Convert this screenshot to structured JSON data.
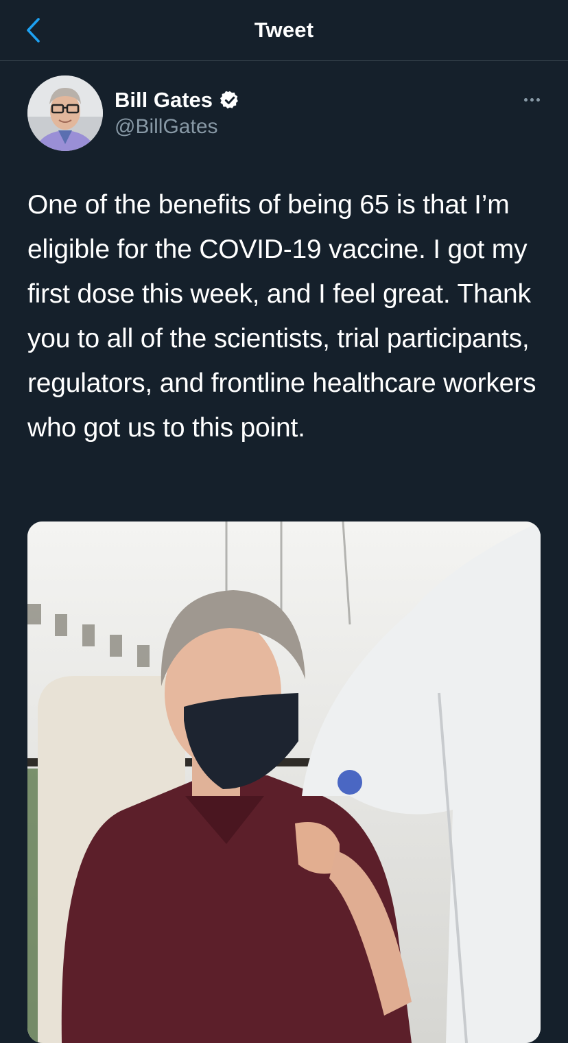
{
  "nav": {
    "title": "Tweet",
    "back_icon": "chevron-left-icon"
  },
  "tweet": {
    "author": {
      "display_name": "Bill Gates",
      "handle": "@BillGates",
      "verified": true,
      "verified_icon": "verified-badge-icon"
    },
    "more_icon": "more-options-icon",
    "text": "One of the benefits of being 65 is that I’m eligible for the COVID-19 vaccine. I got my first dose this week, and I feel great. Thank you to all of the scientists, trial participants, regulators, and frontline healthcare workers who got us to this point.",
    "media": {
      "type": "photo"
    }
  },
  "colors": {
    "background": "#15202b",
    "accent": "#1da1f2",
    "secondary_text": "#8899a6",
    "divider": "#38444d"
  }
}
